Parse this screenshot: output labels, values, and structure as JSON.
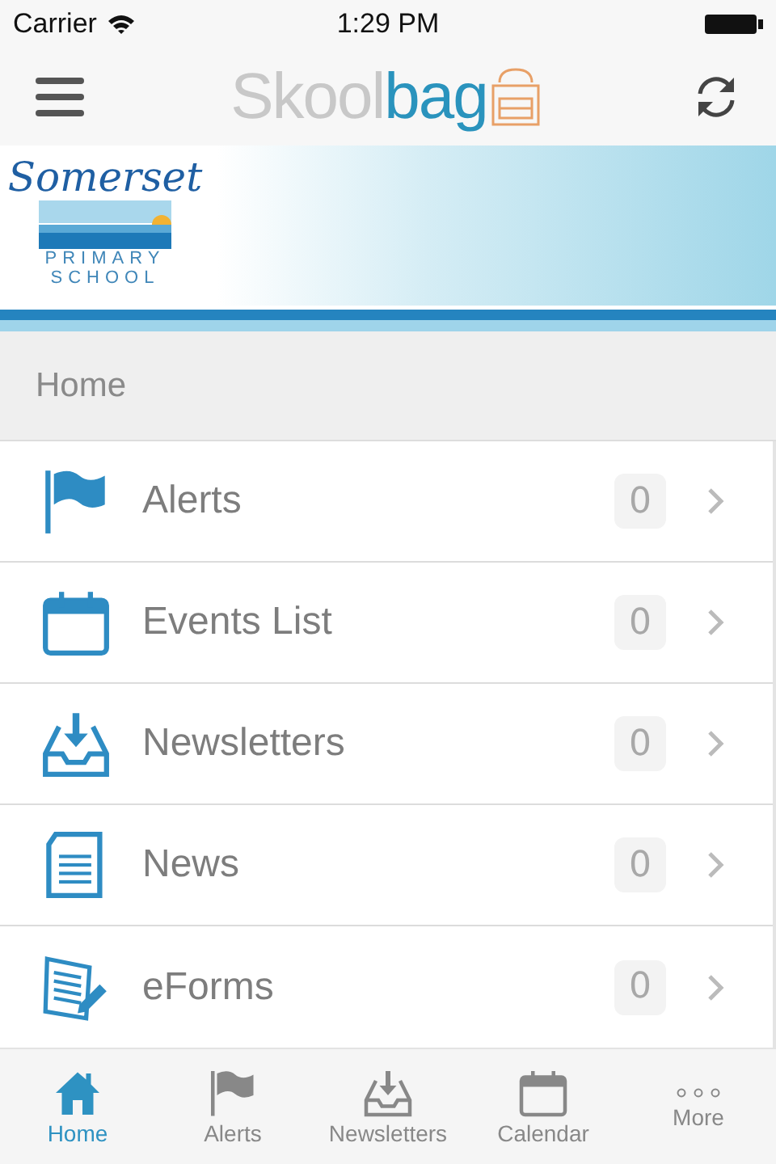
{
  "status_bar": {
    "carrier": "Carrier",
    "time": "1:29 PM"
  },
  "nav_bar": {
    "logo": {
      "part_1": "Skool",
      "part_2": "bag"
    }
  },
  "banner": {
    "school_name": "Somerset",
    "school_type_1": "PRIMARY",
    "school_type_2": "SCHOOL"
  },
  "section_header": "Home",
  "menu_items": [
    {
      "label": "Alerts",
      "kind": "flag",
      "count": "0"
    },
    {
      "label": "Events List",
      "kind": "calendar",
      "count": "0"
    },
    {
      "label": "Newsletters",
      "kind": "inbox",
      "count": "0"
    },
    {
      "label": "News",
      "kind": "document",
      "count": "0"
    },
    {
      "label": "eForms",
      "kind": "form",
      "count": "0"
    }
  ],
  "tab_bar": [
    {
      "label": "Home",
      "kind": "home",
      "selected": true
    },
    {
      "label": "Alerts",
      "kind": "flag",
      "selected": false
    },
    {
      "label": "Newsletters",
      "kind": "inbox",
      "selected": false
    },
    {
      "label": "Calendar",
      "kind": "calendar",
      "selected": false
    },
    {
      "label": "More",
      "kind": "dots",
      "selected": false
    }
  ]
}
